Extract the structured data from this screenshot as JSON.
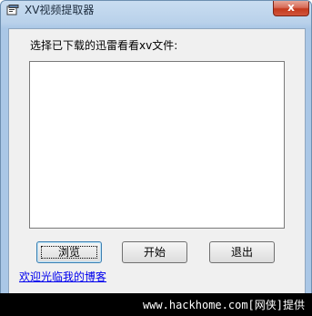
{
  "window": {
    "title": "XV视频提取器",
    "close_label": "x"
  },
  "main": {
    "prompt": "选择已下载的迅雷看看xv文件:",
    "buttons": {
      "browse": "浏览",
      "start": "开始",
      "exit": "退出"
    },
    "link": "欢迎光临我的博客"
  },
  "watermark": "www.hackhome.com[网侠]提供",
  "colors": {
    "client_bg": "#f0f0f0",
    "close_button": "#c4391d",
    "link": "#0000ee",
    "watermark_bg": "#000000"
  }
}
